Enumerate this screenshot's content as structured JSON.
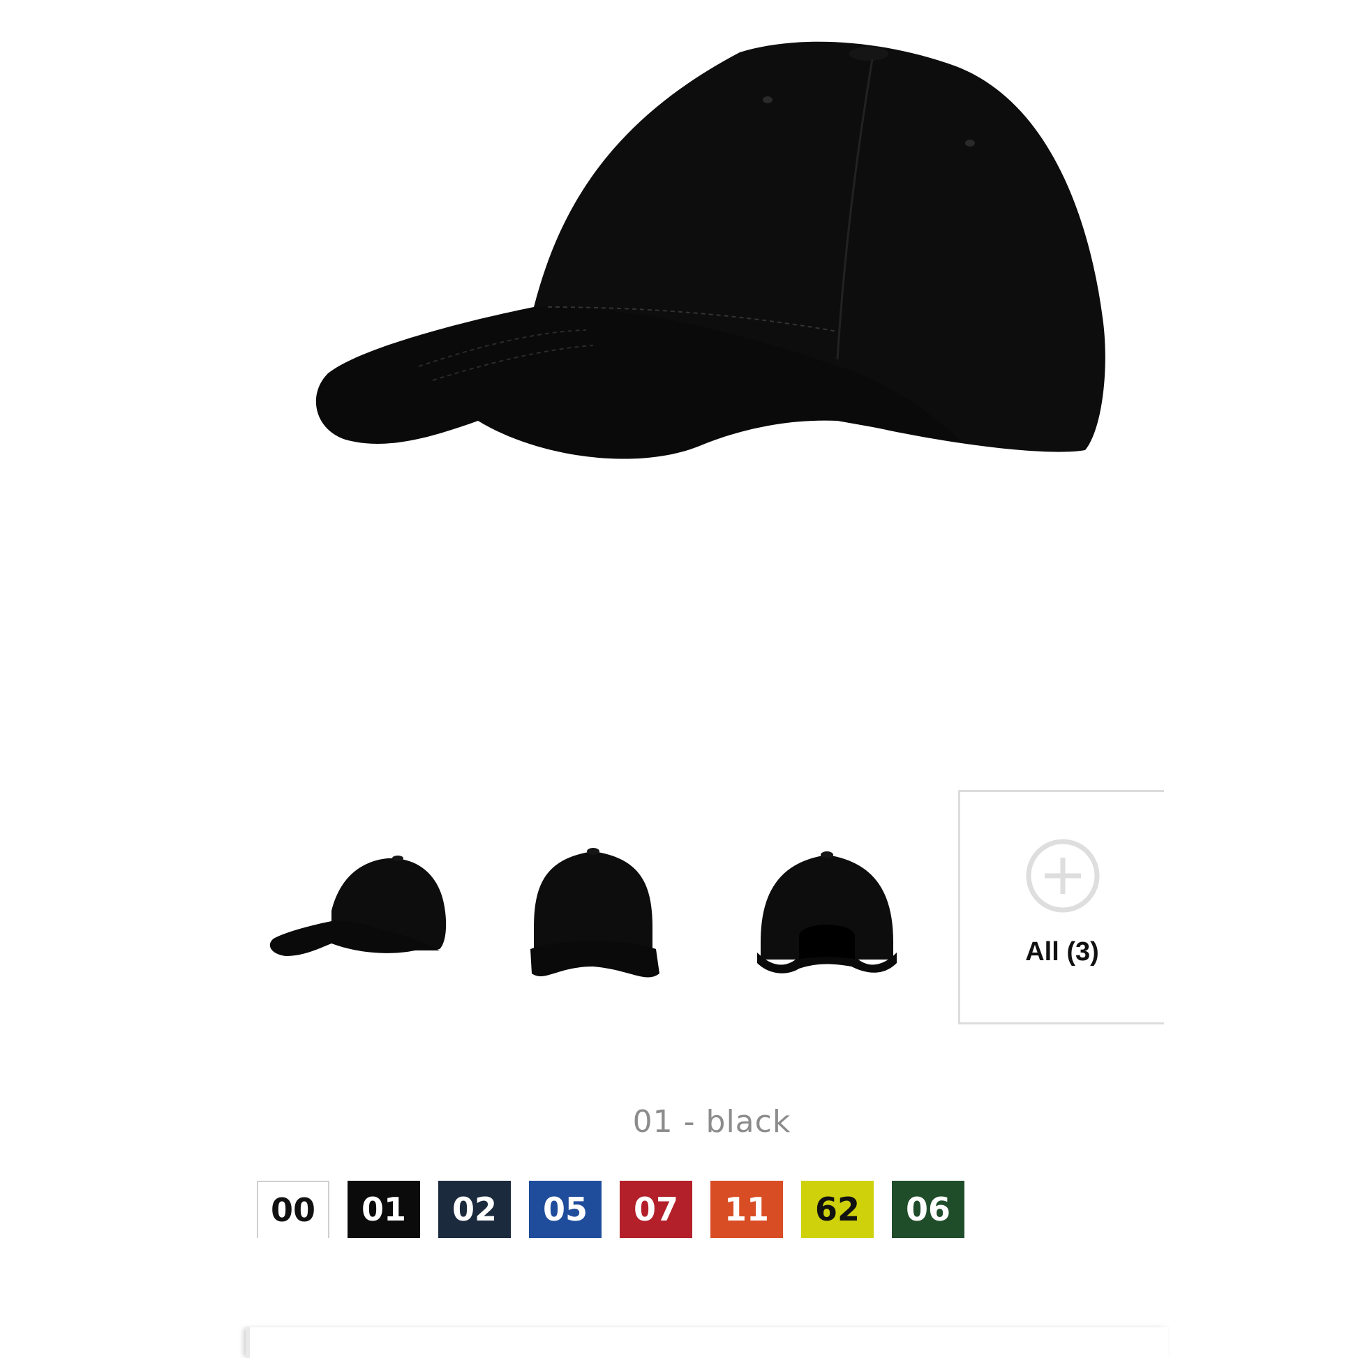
{
  "product": {
    "main_image_icon": "cap-black-side-view",
    "selected_color_label": "01 - black"
  },
  "gallery": {
    "thumbnails": [
      {
        "icon": "cap-side-thumbnail"
      },
      {
        "icon": "cap-front-thumbnail"
      },
      {
        "icon": "cap-back-thumbnail"
      }
    ],
    "all_button": {
      "label": "All (3)",
      "icon": "plus-circle-icon"
    }
  },
  "swatches": [
    {
      "code": "00",
      "bg": "#ffffff",
      "fg": "#111111"
    },
    {
      "code": "01",
      "bg": "#0b0b0b",
      "fg": "#ffffff"
    },
    {
      "code": "02",
      "bg": "#1c2a3e",
      "fg": "#ffffff"
    },
    {
      "code": "05",
      "bg": "#1f4d9c",
      "fg": "#ffffff"
    },
    {
      "code": "07",
      "bg": "#b3202a",
      "fg": "#ffffff"
    },
    {
      "code": "11",
      "bg": "#d94d24",
      "fg": "#ffffff"
    },
    {
      "code": "62",
      "bg": "#cfd20b",
      "fg": "#111111"
    },
    {
      "code": "06",
      "bg": "#1f4d2a",
      "fg": "#ffffff"
    }
  ]
}
